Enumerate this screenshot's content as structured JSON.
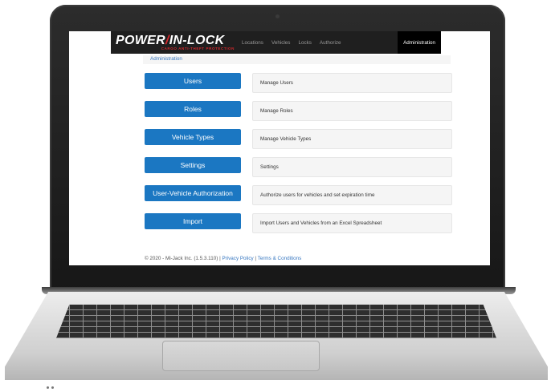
{
  "app": {
    "logo_main_left": "POWER",
    "logo_slash": "/",
    "logo_main_right": "IN-LOCK",
    "logo_sub": "CARGO ANTI-THEFT PROTECTION"
  },
  "nav": {
    "items": [
      "Locations",
      "Vehicles",
      "Locks",
      "Authorize"
    ],
    "active": "Administration"
  },
  "breadcrumb": "Administration",
  "admin_rows": [
    {
      "button": "Users",
      "description": "Manage Users"
    },
    {
      "button": "Roles",
      "description": "Manage Roles"
    },
    {
      "button": "Vehicle Types",
      "description": "Manage Vehicle Types"
    },
    {
      "button": "Settings",
      "description": "Settings"
    },
    {
      "button": "User-Vehicle Authorization",
      "description": "Authorize users for vehicles and set expiration time"
    },
    {
      "button": "Import",
      "description": "Import Users and Vehicles from an Excel Spreadsheet"
    }
  ],
  "footer": {
    "copyright": "© 2020 - Mi-Jack Inc. (1.5.3.110) |",
    "privacy": "Privacy Policy",
    "separator": "|",
    "terms": "Terms & Conditions"
  },
  "colors": {
    "button_blue": "#1b77c2",
    "link_blue": "#3777c0",
    "logo_red": "#d6282c",
    "navbar": "#1f1f1f"
  }
}
